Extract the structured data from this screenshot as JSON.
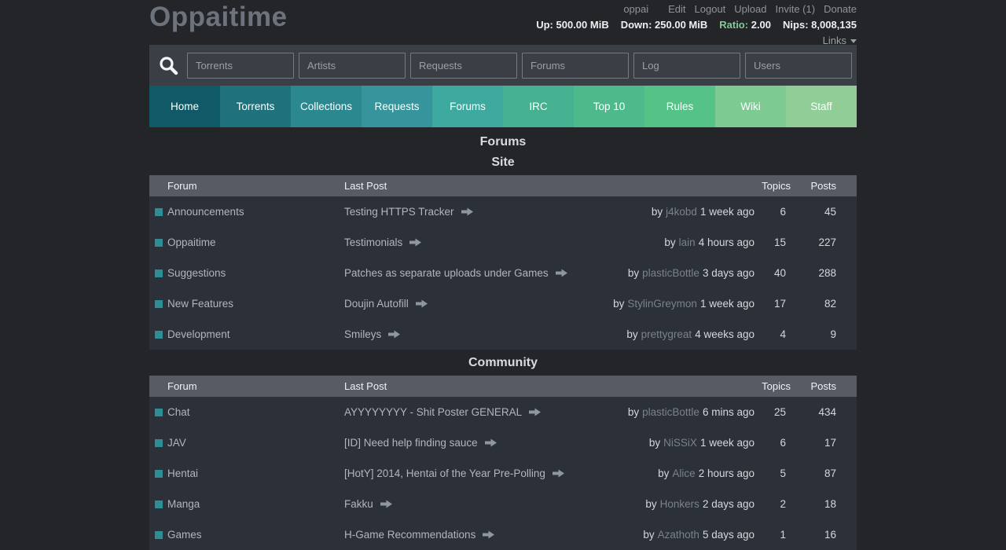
{
  "header": {
    "logo": "Oppaitime",
    "username": "oppai",
    "user_links": [
      "Edit",
      "Logout",
      "Upload",
      "Invite (1)",
      "Donate"
    ],
    "stats": [
      {
        "label": "Up:",
        "value": "500.00 MiB",
        "highlight": false
      },
      {
        "label": "Down:",
        "value": "250.00 MiB",
        "highlight": false
      },
      {
        "label": "Ratio:",
        "value": "2.00",
        "highlight": true
      },
      {
        "label": "Nips:",
        "value": "8,008,135",
        "highlight": false
      }
    ],
    "links_label": "Links",
    "accent_green": "#7fcb93"
  },
  "search": {
    "fields": [
      "Torrents",
      "Artists",
      "Requests",
      "Forums",
      "Log",
      "Users"
    ]
  },
  "nav": {
    "tabs": [
      {
        "label": "Home",
        "color": "#0f5a66"
      },
      {
        "label": "Torrents",
        "color": "#1f717b"
      },
      {
        "label": "Collections",
        "color": "#2c888f"
      },
      {
        "label": "Requests",
        "color": "#36959c"
      },
      {
        "label": "Forums",
        "color": "#3ea99e"
      },
      {
        "label": "IRC",
        "color": "#46b191"
      },
      {
        "label": "Top 10",
        "color": "#4eba8c"
      },
      {
        "label": "Rules",
        "color": "#55c288"
      },
      {
        "label": "Wiki",
        "color": "#7eca93"
      },
      {
        "label": "Staff",
        "color": "#90cd97"
      }
    ]
  },
  "page": {
    "title": "Forums"
  },
  "labels": {
    "by": "by"
  },
  "sections": [
    {
      "title": "Site",
      "columns": [
        "Forum",
        "Last Post",
        "Topics",
        "Posts"
      ],
      "rows": [
        {
          "forum": "Announcements",
          "last_post": "Testing HTTPS Tracker",
          "by": "j4kobd",
          "time": "1 week ago",
          "topics": "6",
          "posts": "45"
        },
        {
          "forum": "Oppaitime",
          "last_post": "Testimonials",
          "by": "lain",
          "time": "4 hours ago",
          "topics": "15",
          "posts": "227"
        },
        {
          "forum": "Suggestions",
          "last_post": "Patches as separate uploads under Games",
          "by": "plasticBottle",
          "time": "3 days ago",
          "topics": "40",
          "posts": "288"
        },
        {
          "forum": "New Features",
          "last_post": "Doujin Autofill",
          "by": "StylinGreymon",
          "time": "1 week ago",
          "topics": "17",
          "posts": "82"
        },
        {
          "forum": "Development",
          "last_post": "Smileys",
          "by": "prettygreat",
          "time": "4 weeks ago",
          "topics": "4",
          "posts": "9"
        }
      ]
    },
    {
      "title": "Community",
      "columns": [
        "Forum",
        "Last Post",
        "Topics",
        "Posts"
      ],
      "rows": [
        {
          "forum": "Chat",
          "last_post": "AYYYYYYYY - Shit Poster GENERAL",
          "by": "plasticBottle",
          "time": "6 mins ago",
          "topics": "25",
          "posts": "434"
        },
        {
          "forum": "JAV",
          "last_post": "[ID] Need help finding sauce",
          "by": "NiSSiX",
          "time": "1 week ago",
          "topics": "6",
          "posts": "17"
        },
        {
          "forum": "Hentai",
          "last_post": "[HotY] 2014, Hentai of the Year Pre-Polling",
          "by": "Alice",
          "time": "2 hours ago",
          "topics": "5",
          "posts": "87"
        },
        {
          "forum": "Manga",
          "last_post": "Fakku",
          "by": "Honkers",
          "time": "2 days ago",
          "topics": "2",
          "posts": "18"
        },
        {
          "forum": "Games",
          "last_post": "H-Game Recommendations",
          "by": "Azathoth",
          "time": "5 days ago",
          "topics": "1",
          "posts": "16"
        }
      ]
    }
  ]
}
